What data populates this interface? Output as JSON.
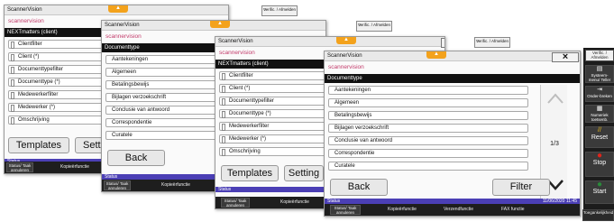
{
  "app_title": "ScannerVision",
  "logo_text": "scannervision",
  "logo_suffix": "v",
  "close_glyph": "×",
  "tab_glyph": "▲",
  "verif_label": "Verific. / Afmelden",
  "panel1": {
    "heading": "NEXTmatters (client)",
    "items": [
      "Clientfilter",
      "Client (*)",
      "Documenttypefilter",
      "Documenttype (*)",
      "Medewerkerfilter",
      "Medewerker (*)",
      "Omschrijving"
    ],
    "templates_label": "Templates",
    "settings_label": "Setti",
    "status_label": "Status",
    "bb_button": "Status/ Taak annuleren",
    "bb_text": "Kopieërfunctie"
  },
  "panel2": {
    "heading": "Documenttype",
    "items": [
      "Aantekeningen",
      "Algemeen",
      "Betalingsbewijs",
      "Bijlagen verzoekschrift",
      "Conclusie van antwoord",
      "Correspondentie",
      "Curatele"
    ],
    "back_label": "Back",
    "status_label": "Status",
    "bb_button": "Status/ Taak annuleren",
    "bb_text": "Kopieërfunctie"
  },
  "panel3": {
    "heading": "NEXTmatters (client)",
    "items": [
      "Clientfilter",
      "Client (*)",
      "Documenttypefilter",
      "Documenttype (*)",
      "Medewerkerfilter",
      "Medewerker (*)",
      "Omschrijving"
    ],
    "templates_label": "Templates",
    "settings_label": "Setting",
    "status_label": "Status",
    "bb_button": "Status/ Taak annuleren",
    "bb_text": "Kopieërfunctie"
  },
  "panel4": {
    "heading": "Documenttype",
    "items": [
      "Aantekeningen",
      "Algemeen",
      "Betalingsbewijs",
      "Bijlagen verzoekschrift",
      "Conclusie van antwoord",
      "Correspondentie",
      "Curatele"
    ],
    "page": "1/3",
    "back_label": "Back",
    "filter_label": "Filter",
    "status_label": "Status",
    "datetime": "11/06/2020 11:45",
    "bb_button": "Status/ Taak annuleren",
    "bb_items": [
      "Kopieërfunctie",
      "Verzendfunctie",
      "FAX functie"
    ],
    "bb_right": "Toegankelijkheid"
  },
  "side_menu": {
    "top_label": "Verific. / Afmelden",
    "items": [
      "Systeem-menu/ Teller",
      "Onder-breken",
      "Numeriek toetsenb.",
      "Reset",
      "Stop",
      "Start"
    ]
  },
  "colors": {
    "accent_tab": "#f3a21c",
    "status_bar": "#4b3fb5",
    "logo": "#c23a6a",
    "stop": "#e0241b",
    "start": "#2a8a3a"
  }
}
